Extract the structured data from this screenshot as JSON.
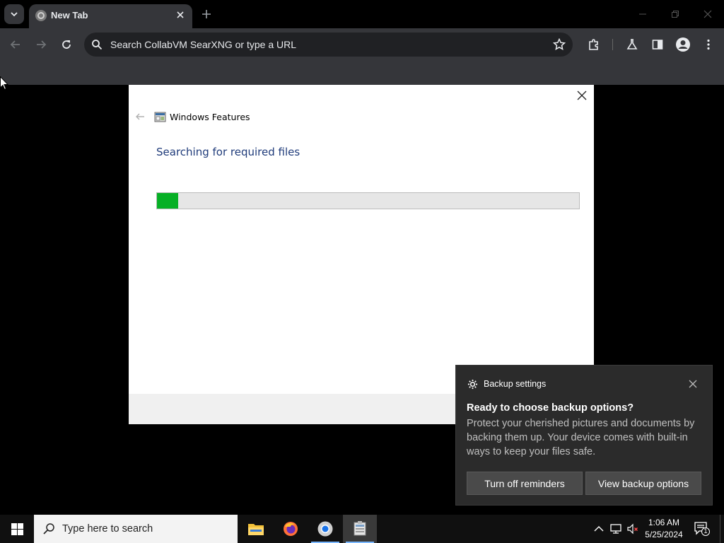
{
  "browser": {
    "tab": {
      "title": "New Tab"
    },
    "omnibox": {
      "placeholder": "Search CollabVM SearXNG or type a URL"
    }
  },
  "dialog": {
    "title": "Windows Features",
    "heading": "Searching for required files",
    "progress_fraction": 0.05
  },
  "toast": {
    "app_name": "Backup settings",
    "title": "Ready to choose backup options?",
    "body": "Protect your cherished pictures and documents by backing them up. Your device comes with built-in ways to keep your files safe.",
    "button_turn_off": "Turn off reminders",
    "button_view": "View backup options"
  },
  "taskbar": {
    "search_placeholder": "Type here to search",
    "time": "1:06 AM",
    "date": "5/25/2024",
    "notification_count": "1"
  },
  "colors": {
    "progress_fill": "#06b025",
    "dialog_heading": "#1f3b7a",
    "chrome_bg": "#35363a",
    "taskbar_bg": "#101010"
  }
}
